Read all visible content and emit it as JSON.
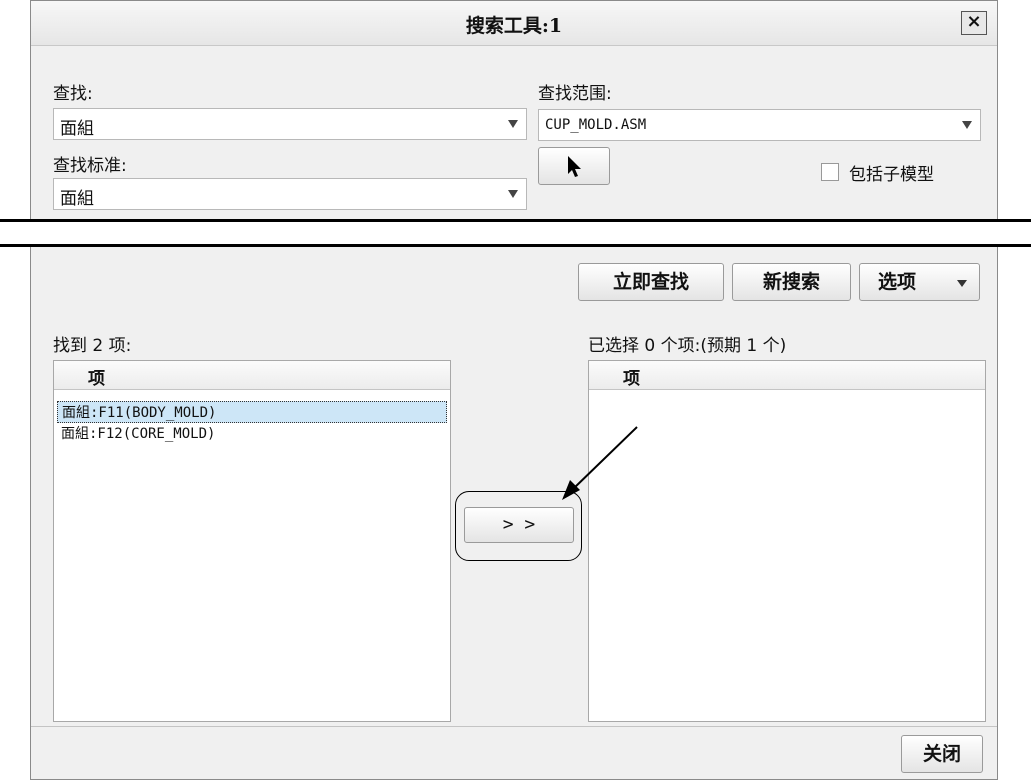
{
  "dialog": {
    "title": "搜索工具:1",
    "close_icon": "×"
  },
  "lookfor": {
    "label": "查找:",
    "value": "面組"
  },
  "lookin": {
    "label": "查找范围:",
    "value": "CUP_MOLD.ASM"
  },
  "criteria": {
    "label": "查找标准:",
    "value": "面組"
  },
  "include_submodels": {
    "label": "包括子模型",
    "checked": false
  },
  "buttons": {
    "find_now": "立即查找",
    "new_search": "新搜索",
    "options": "选项",
    "transfer": "> >",
    "close": "关闭"
  },
  "found": {
    "label": "找到 2 项:",
    "column": "项",
    "items": [
      "面組:F11(BODY_MOLD)",
      "面組:F12(CORE_MOLD)"
    ]
  },
  "selected": {
    "label": "已选择 0 个项:(预期 1 个)",
    "column": "项",
    "items": []
  }
}
